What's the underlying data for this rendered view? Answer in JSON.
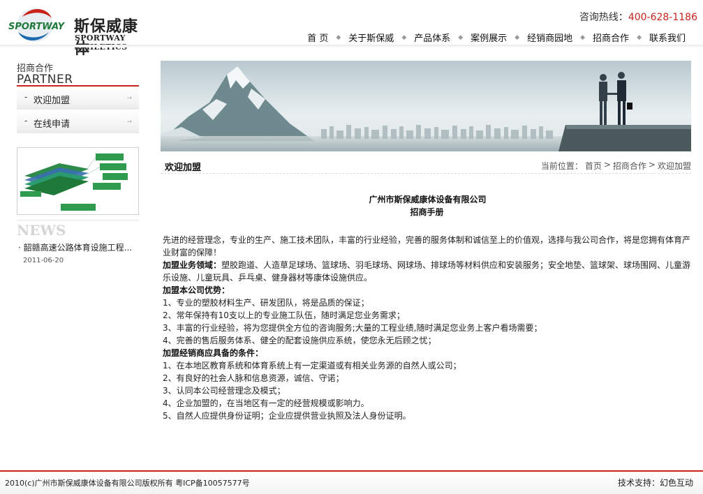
{
  "header": {
    "logo": {
      "badge_text": "SPORTWAY",
      "name_cn": "斯保威康体",
      "name_en": "SPORTWAY ATHLETICS"
    },
    "hotline_label": "咨询热线：",
    "hotline_number": "400-628-1186",
    "nav": [
      "首 页",
      "关于斯保威",
      "产品体系",
      "案例展示",
      "经销商园地",
      "招商合作",
      "联系我们"
    ],
    "brand_color": "#c8221a"
  },
  "sidebar": {
    "title_cn": "招商合作",
    "title_en": "PARTNER",
    "menu": [
      {
        "dash": "-",
        "label": "欢迎加盟",
        "arrow": "→"
      },
      {
        "dash": "-",
        "label": "在线申请",
        "arrow": "→"
      }
    ],
    "news": {
      "heading": "NEWS",
      "items": [
        {
          "bullet": "·",
          "title": "韶赣高速公路体育设施工程...",
          "date": "2011-06-20"
        }
      ]
    }
  },
  "content": {
    "section_title": "欢迎加盟",
    "breadcrumb": {
      "prefix": "当前位置：",
      "items": [
        "首页",
        "招商合作",
        "欢迎加盟"
      ],
      "separator": ">"
    },
    "article": {
      "company": "广州市斯保威康体设备有限公司",
      "subtitle": "招商手册",
      "intro": "先进的经营理念，专业的生产、施工技术团队，丰富的行业经验，完善的服务体制和诚信至上的价值观，选择与我公司合作，将是您拥有体育产业财富的保障！",
      "scope_label": "加盟业务领域：",
      "scope_text": "塑胶跑道、人造草足球场、篮球场、羽毛球场、网球场、排球场等材料供应和安装服务；安全地垫、篮球架、球场围网、儿童游乐设施、儿童玩具、乒乓桌、健身器材等康体设施供应。",
      "advantages_label": "加盟本公司优势：",
      "advantages": [
        "1、专业的塑胶材料生产、研发团队，将是品质的保证；",
        "2、常年保持有10支以上的专业施工队伍，随时满足您业务需求；",
        "3、丰富的行业经验，将为您提供全方位的咨询服务;大量的工程业绩,随时满足您业务上客户看场需要；",
        "4、完善的售后服务体系、健全的配套设施供应系统，使您永无后顾之忧；"
      ],
      "conditions_label": "加盟经销商应具备的条件：",
      "conditions": [
        "1、在本地区教育系统和体育系统上有一定渠道或有相关业务源的自然人或公司；",
        "2、有良好的社会人脉和信息资源，诚信、守诺；",
        "3、认同本公司经营理念及模式；",
        "4、企业加盟的，在当地区有一定的经营规模或影响力。",
        "5、自然人应提供身份证明；企业应提供营业执照及法人身份证明。"
      ]
    }
  },
  "footer": {
    "copyright": "2010(c)广州市斯保威康体设备有限公司版权所有 粤ICP备10057577号",
    "support": "技术支持：幻色互动"
  }
}
